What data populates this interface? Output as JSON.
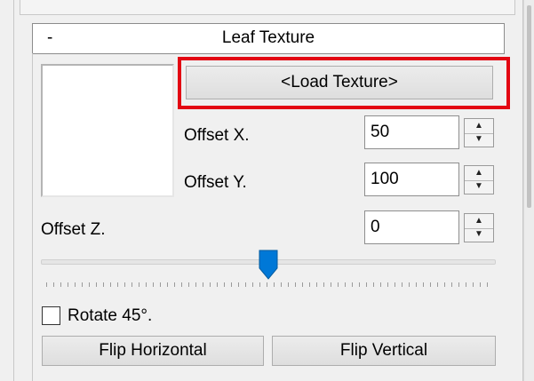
{
  "panel": {
    "collapse_symbol": "-",
    "title": "Leaf Texture"
  },
  "texture": {
    "load_button_label": "<Load Texture>"
  },
  "offsets": {
    "x": {
      "label": "Offset X.",
      "value": "50"
    },
    "y": {
      "label": "Offset Y.",
      "value": "100"
    },
    "z": {
      "label": "Offset Z.",
      "value": "0"
    }
  },
  "slider": {
    "value_fraction": 0.5
  },
  "rotate": {
    "label": "Rotate 45°.",
    "checked": false
  },
  "flip": {
    "horizontal_label": "Flip Horizontal",
    "vertical_label": "Flip Vertical"
  },
  "colors": {
    "highlight": "#e30613",
    "slider_thumb": "#0078d7"
  }
}
